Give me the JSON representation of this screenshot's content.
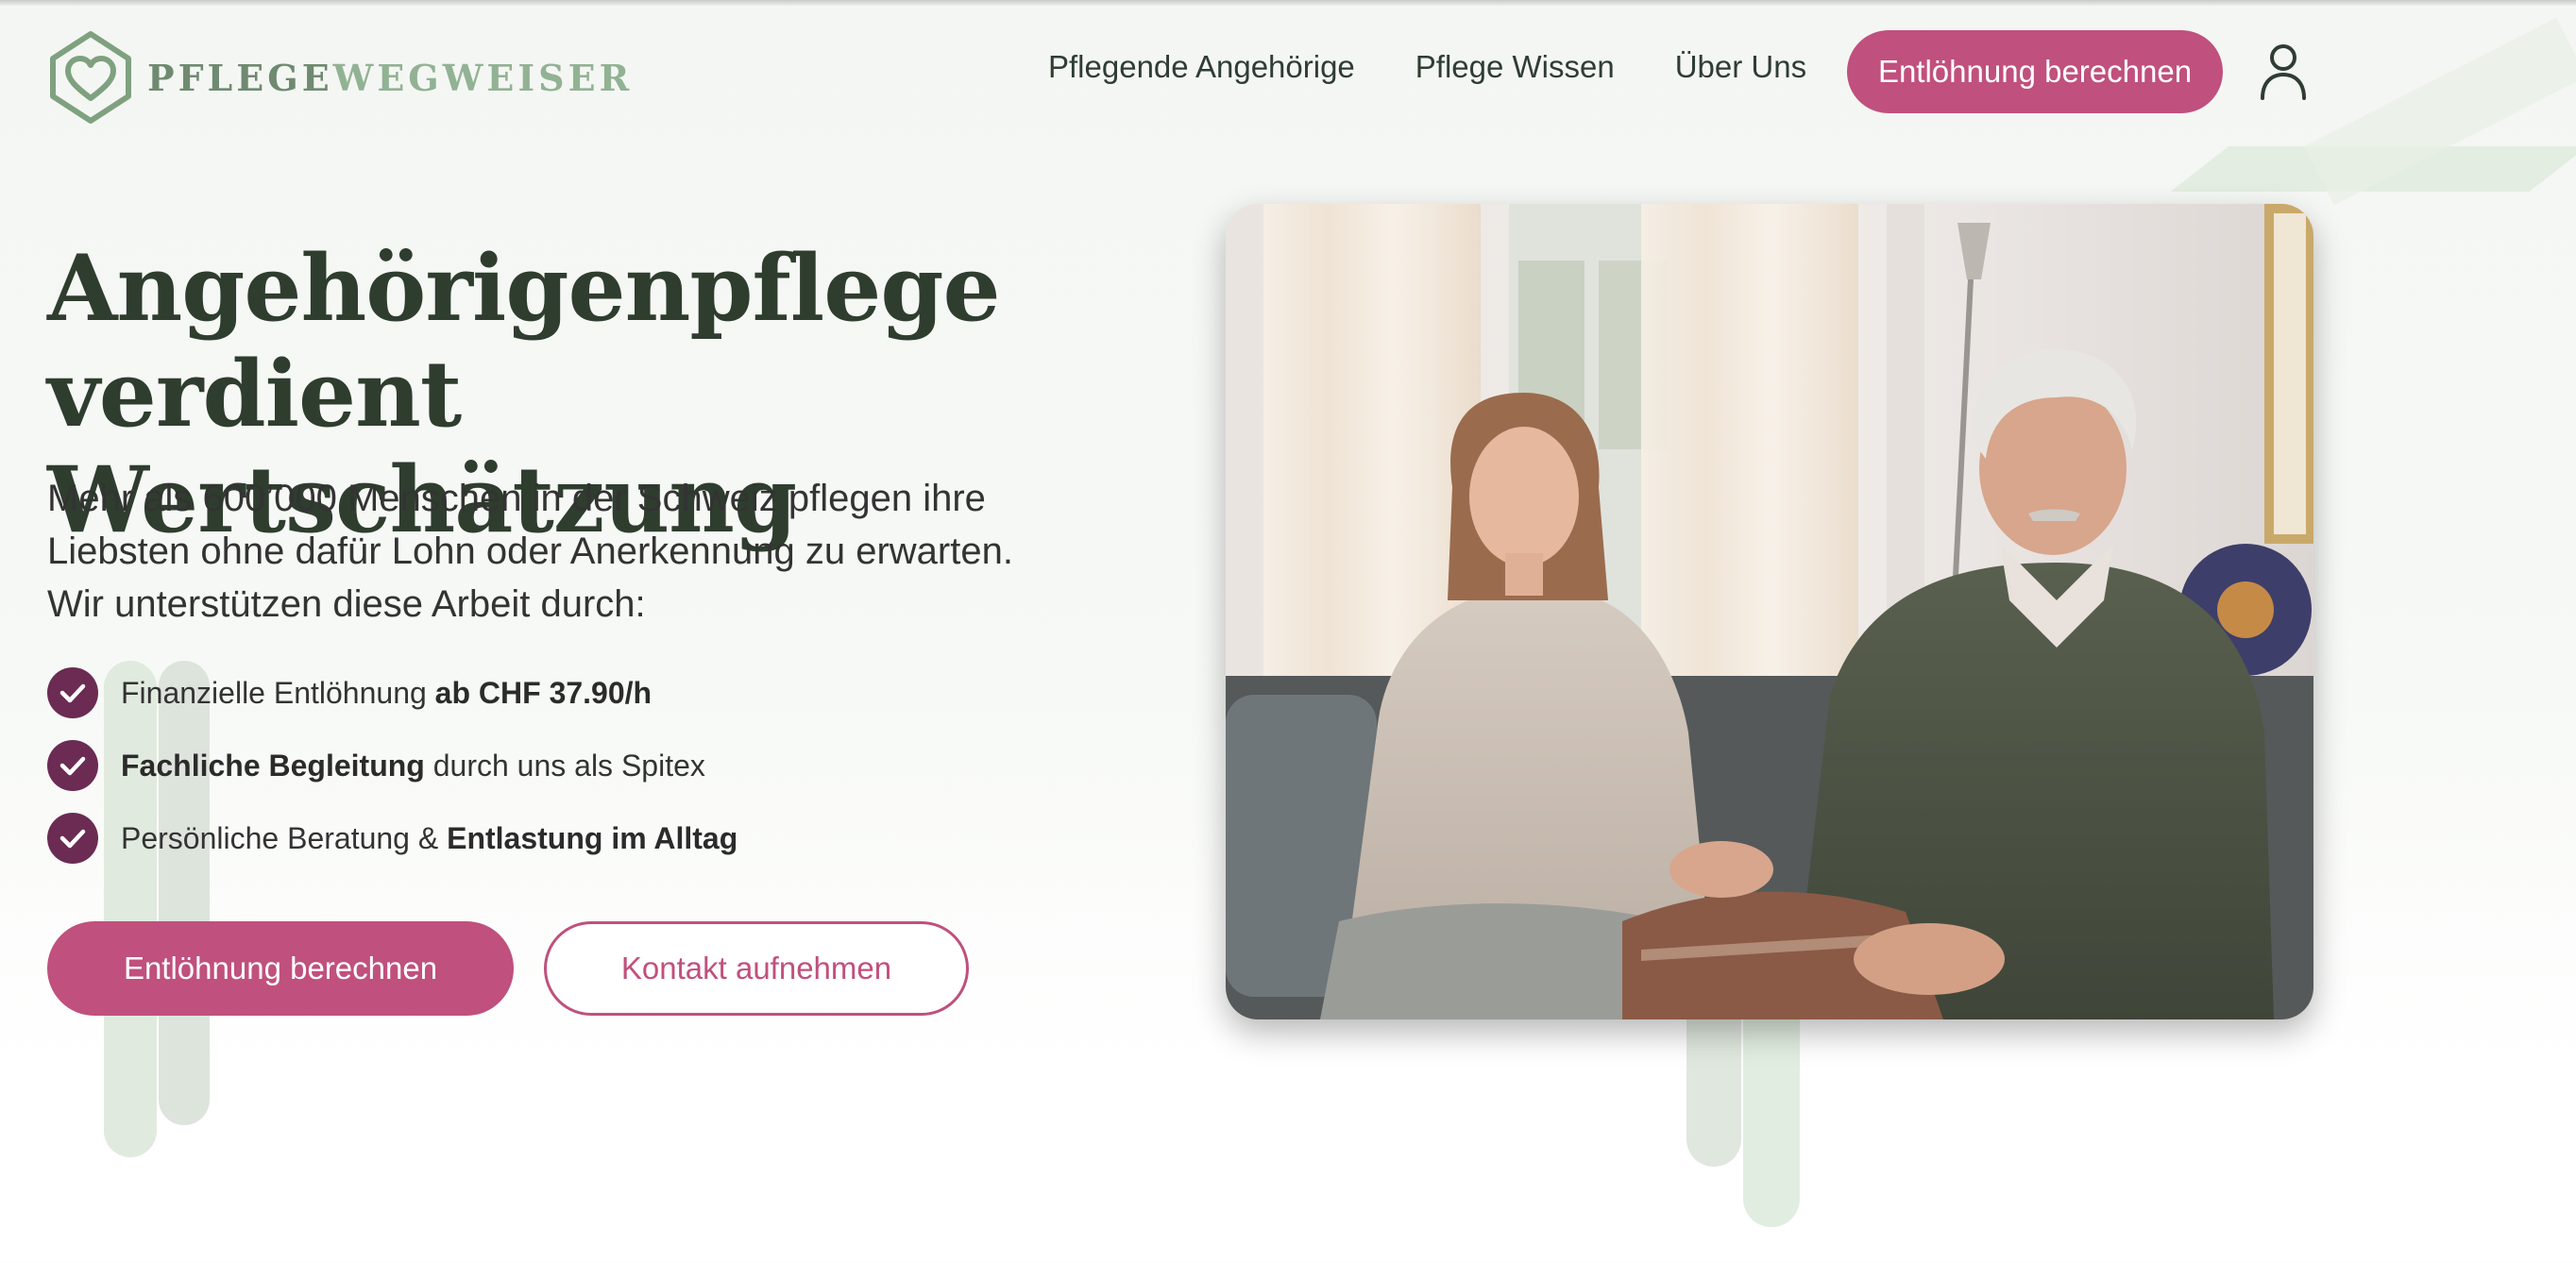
{
  "brand": {
    "name_part1": "PFLEGE",
    "name_part2": "WEGWEISER",
    "logo_icon": "heart-house-icon",
    "colors": {
      "green_dark": "#6f8a70",
      "green_light": "#92b294",
      "accent_pink": "#c0507d",
      "check_purple": "#6b2b53"
    }
  },
  "nav": {
    "items": [
      {
        "label": "Pflegende Angehörige"
      },
      {
        "label": "Pflege Wissen"
      },
      {
        "label": "Über Uns"
      }
    ],
    "cta_label": "Entlöhnung berechnen",
    "user_icon": "user-icon"
  },
  "hero": {
    "title_line1": "Angehörigenpflege",
    "title_line2": "verdient Wertschätzung",
    "intro": "Mehr als 600’000 Menschen in der Schweiz pflegen ihre Liebsten ohne dafür Lohn oder Anerkennung zu erwarten. Wir unterstützen diese Arbeit durch:",
    "benefits": [
      {
        "before": "Finanzielle Entlöhnung ",
        "bold": "ab CHF 37.90/h",
        "after": ""
      },
      {
        "before": "",
        "bold": "Fachliche Begleitung",
        "after": " durch uns als Spitex"
      },
      {
        "before": "Persönliche Beratung & ",
        "bold": "Entlastung im Alltag",
        "after": ""
      }
    ],
    "primary_button": "Entlöhnung berechnen",
    "secondary_button": "Kontakt aufnehmen",
    "image": "photo of a smiling young woman holding the hand of an elderly man on a sofa"
  }
}
